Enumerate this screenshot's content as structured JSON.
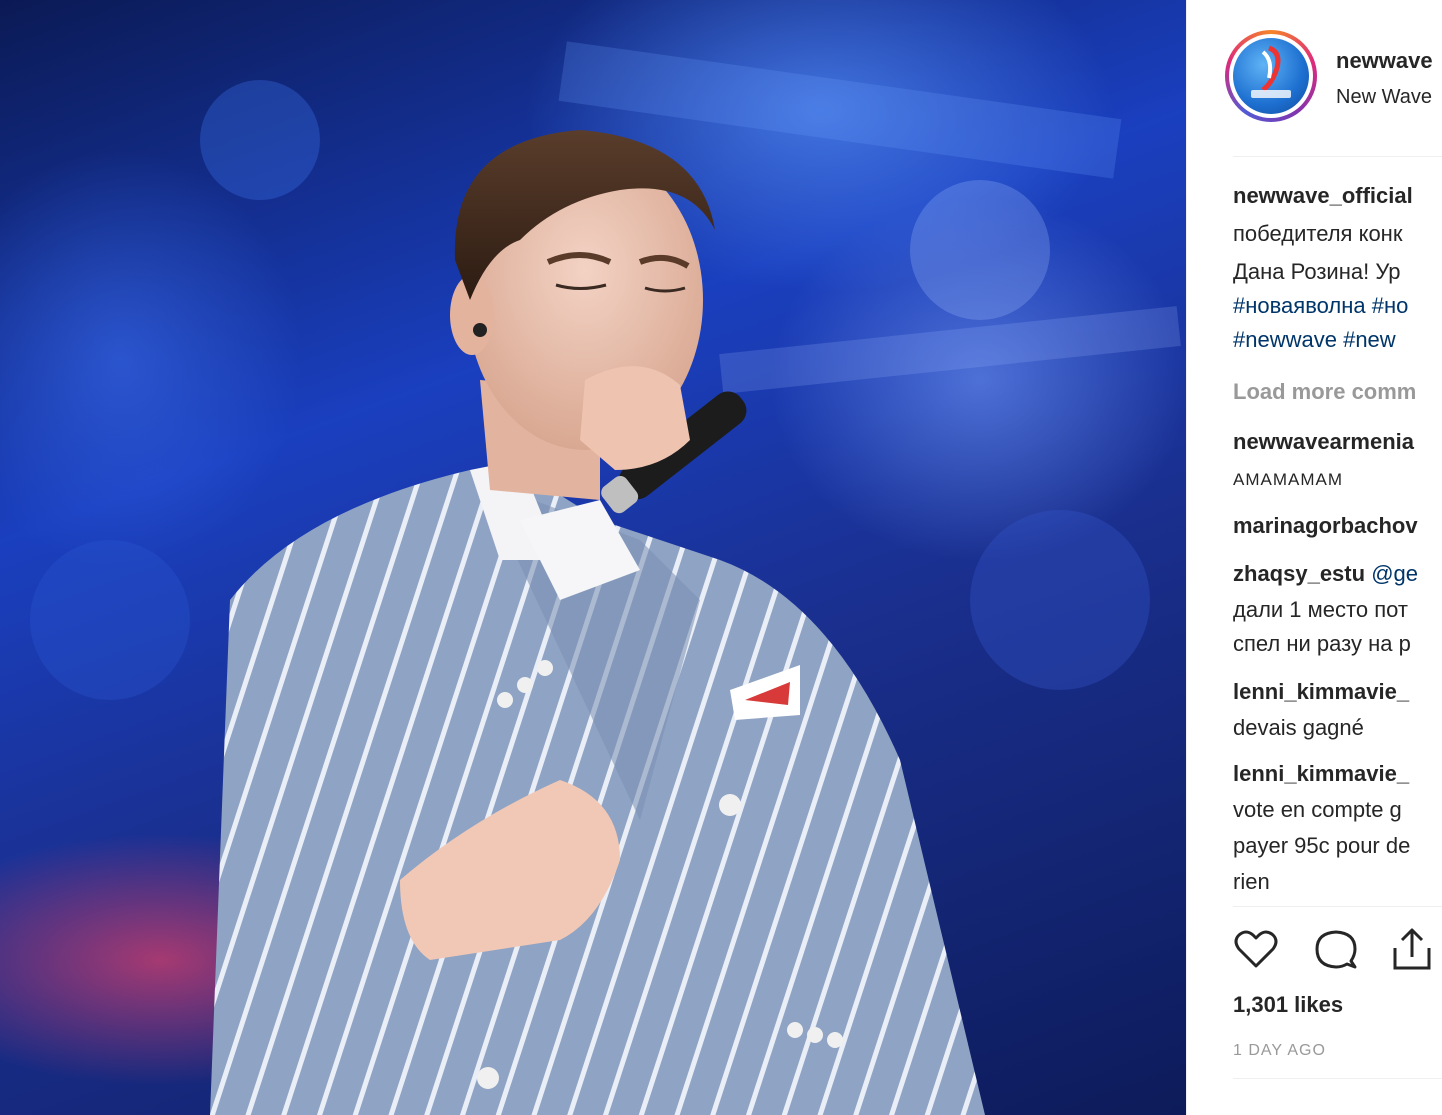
{
  "post": {
    "username": "newwave",
    "location": "New Wave",
    "caption": {
      "username": "newwave_official",
      "lines": [
        "победителя конк",
        "Дана Розина! Ур"
      ],
      "hashtags_line1": [
        "#новаяволна",
        "#но"
      ],
      "hashtags_line2": [
        "#newwave",
        "#new"
      ]
    },
    "load_more": "Load more comm",
    "comments": [
      {
        "username": "newwavearmenia",
        "text_lines": [
          "АМАМАМАМ"
        ]
      },
      {
        "username": "marinagorbachov",
        "text_lines": []
      },
      {
        "username": "zhaqsy_estu",
        "mention": "@ge",
        "text_lines": [
          "дали 1 место пот",
          "спел ни разу на р"
        ]
      },
      {
        "username": "lenni_kimmavie_",
        "text_lines": [
          "devais gagné"
        ]
      },
      {
        "username": "lenni_kimmavie_",
        "text_lines": [
          "vote en compte g",
          "payer 95c pour de",
          "rien"
        ]
      }
    ],
    "likes": "1,301 likes",
    "time_ago": "1 DAY AGO"
  },
  "icons": [
    "heart-icon",
    "comment-icon",
    "share-icon"
  ],
  "colors": {
    "hashtag": "#003569",
    "muted": "#999999",
    "text": "#262626"
  }
}
